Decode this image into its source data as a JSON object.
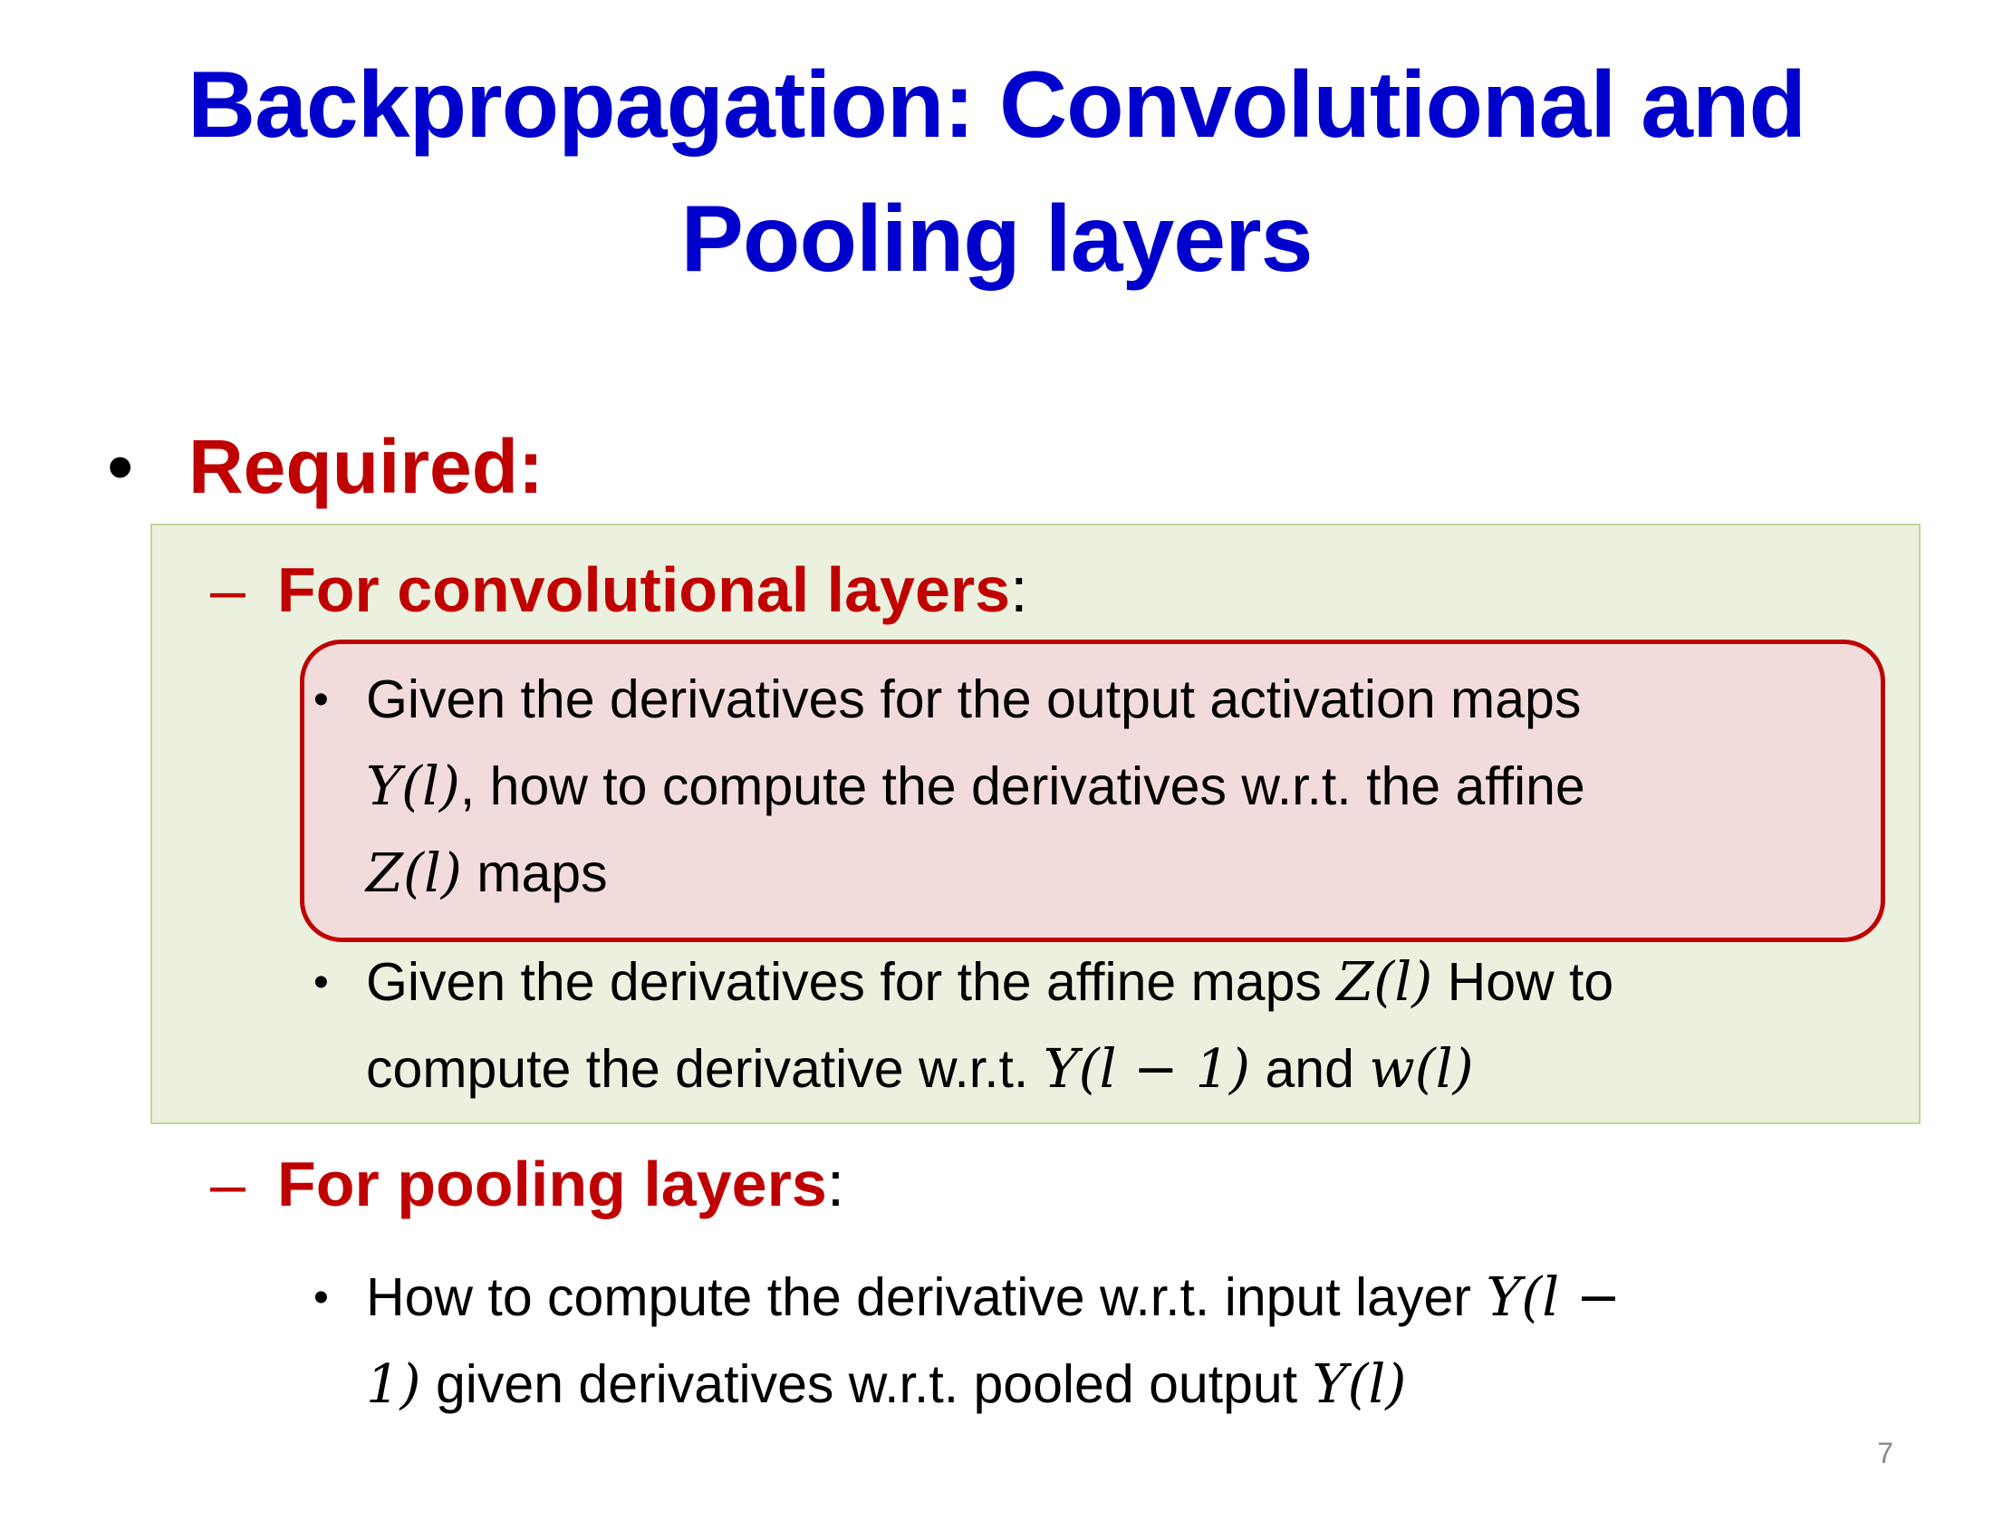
{
  "slide": {
    "title_line1": "Backpropagation: Convolutional and",
    "title_line2": "Pooling layers",
    "required_label": "Required:",
    "conv": {
      "heading": "For convolutional layers",
      "heading_suffix": ":",
      "item1": {
        "line1": "Given the derivatives for the output activation maps",
        "line2_math": "Y(l)",
        "line2_text": ", how to compute the derivatives w.r.t. the affine",
        "line3_math": "Z(l)",
        "line3_text": " maps"
      },
      "item2": {
        "line1_text": "Given the derivatives for the affine maps ",
        "line1_math": "Z(l)",
        "line1_tail": " How to",
        "line2_text": "compute the derivative w.r.t. ",
        "line2_math1": "Y(l − 1)",
        "line2_mid": " and ",
        "line2_math2": "w(l)"
      }
    },
    "pool": {
      "heading": "For pooling layers",
      "heading_suffix": ":",
      "item1": {
        "line1_text": "How to compute the derivative w.r.t. input layer ",
        "line1_math": "Y(l −",
        "line2_math": "1)",
        "line2_text": " given derivatives w.r.t. pooled output ",
        "line2_math2": "Y(l)"
      }
    },
    "page_number": "7"
  },
  "colors": {
    "title": "#0000cc",
    "heading_red": "#c00000",
    "green_box_fill": "#ebf1de",
    "highlight_fill": "#f2dcdb",
    "highlight_border": "#c00000"
  }
}
